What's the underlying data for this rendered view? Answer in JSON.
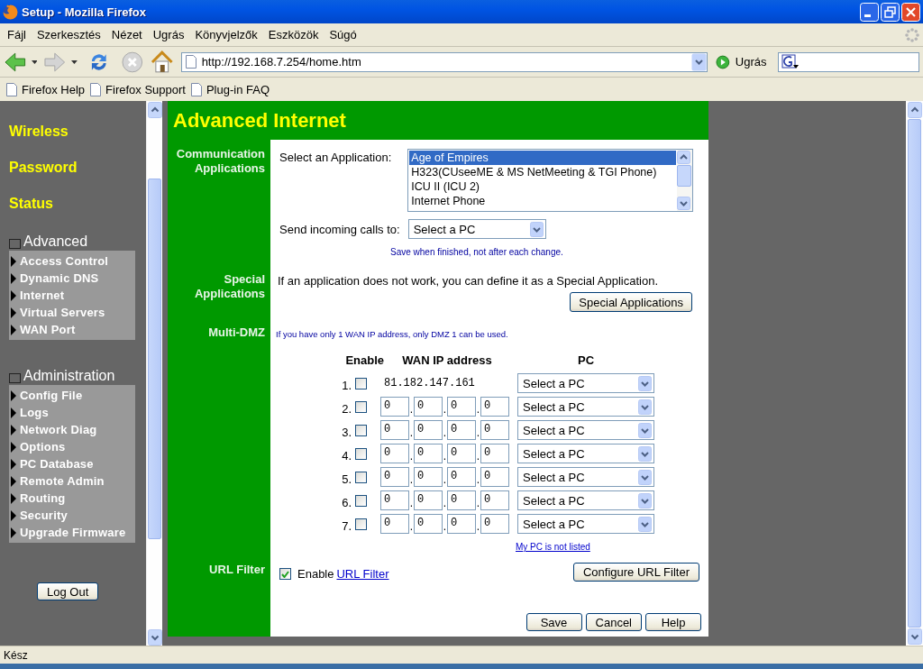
{
  "window": {
    "title": "Setup - Mozilla Firefox"
  },
  "menu": [
    "Fájl",
    "Szerkesztés",
    "Nézet",
    "Ugrás",
    "Könyvjelzők",
    "Eszközök",
    "Súgó"
  ],
  "address": {
    "value": "http://192.168.7.254/home.htm"
  },
  "go_button": "Ugrás",
  "bookmarks": [
    "Firefox Help",
    "Firefox Support",
    "Plug-in FAQ"
  ],
  "sidebar": {
    "links": [
      "Wireless",
      "Password",
      "Status"
    ],
    "groups": [
      {
        "title": "Advanced",
        "items": [
          "Access Control",
          "Dynamic DNS",
          "Internet",
          "Virtual Servers",
          "WAN Port"
        ]
      },
      {
        "title": "Administration",
        "items": [
          "Config File",
          "Logs",
          "Network Diag",
          "Options",
          "PC Database",
          "Remote Admin",
          "Routing",
          "Security",
          "Upgrade Firmware"
        ]
      }
    ],
    "logout": "Log Out"
  },
  "page": {
    "title": "Advanced Internet",
    "communication": {
      "label": "Communication Applications",
      "select_label": "Select an Application:",
      "applications": [
        {
          "name": "Age of Empires",
          "selected": true
        },
        {
          "name": "H323(CUseeME & MS NetMeeting & TGI Phone)",
          "selected": false
        },
        {
          "name": "ICU II (ICU 2)",
          "selected": false
        },
        {
          "name": "Internet Phone",
          "selected": false
        }
      ],
      "send_label": "Send incoming calls to:",
      "send_value": "Select a PC",
      "note": "Save when finished, not after each change."
    },
    "special": {
      "label": "Special Applications",
      "text": "If an application does not work, you can define it as a Special Application.",
      "button": "Special Applications"
    },
    "dmz": {
      "label": "Multi-DMZ",
      "note": "If you have only 1 WAN IP address, only DMZ 1 can be used.",
      "headers": [
        "Enable",
        "WAN IP address",
        "PC"
      ],
      "rows": [
        {
          "number": "1.",
          "enabled": false,
          "kind": "fixed",
          "ip": "81.182.147.161",
          "pc": "Select a PC"
        },
        {
          "number": "2.",
          "enabled": false,
          "kind": "octets",
          "octets": [
            "0",
            "0",
            "0",
            "0"
          ],
          "separators": [
            ".",
            ".",
            "."
          ],
          "pc": "Select a PC"
        },
        {
          "number": "3.",
          "enabled": false,
          "kind": "octets",
          "octets": [
            "0",
            "0",
            "0",
            "0"
          ],
          "separators": [
            ".",
            ".",
            "."
          ],
          "pc": "Select a PC"
        },
        {
          "number": "4.",
          "enabled": false,
          "kind": "octets",
          "octets": [
            "0",
            "0",
            "0",
            "0"
          ],
          "separators": [
            ".",
            ".",
            "."
          ],
          "pc": "Select a PC"
        },
        {
          "number": "5.",
          "enabled": false,
          "kind": "octets",
          "octets": [
            "0",
            "0",
            "0",
            "0"
          ],
          "separators": [
            ".",
            ".",
            "."
          ],
          "pc": "Select a PC"
        },
        {
          "number": "6.",
          "enabled": false,
          "kind": "octets",
          "octets": [
            "0",
            "0",
            "0",
            "0"
          ],
          "separators": [
            ".",
            ".",
            "."
          ],
          "pc": "Select a PC"
        },
        {
          "number": "7.",
          "enabled": false,
          "kind": "octets",
          "octets": [
            "0",
            "0",
            "0",
            "0"
          ],
          "separators": [
            ".",
            ".",
            "."
          ],
          "pc": "Select a PC"
        }
      ],
      "link": "My PC is not listed"
    },
    "url_filter": {
      "label": "URL Filter",
      "checked": true,
      "enable_text": "Enable",
      "link": "URL Filter",
      "button": "Configure URL Filter"
    },
    "buttons": [
      "Save",
      "Cancel",
      "Help"
    ]
  },
  "status_bar": "Kész"
}
